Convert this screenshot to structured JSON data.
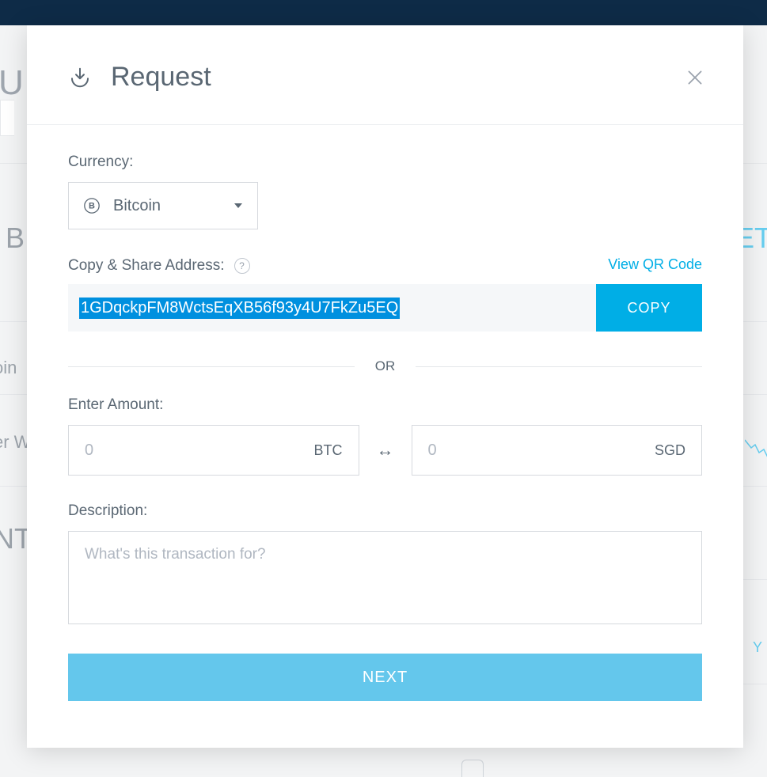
{
  "modal": {
    "title": "Request",
    "currency_label": "Currency:",
    "currency_selected": "Bitcoin",
    "address_label": "Copy & Share Address:",
    "qr_link": "View QR Code",
    "address_value": "1GDqckpFM8WctsEqXB56f93y4U7FkZu5EQ",
    "copy_button": "COPY",
    "or_label": "OR",
    "amount_label": "Enter Amount:",
    "amount_crypto_placeholder": "0",
    "amount_crypto_unit": "BTC",
    "amount_fiat_placeholder": "0",
    "amount_fiat_unit": "SGD",
    "description_label": "Description:",
    "description_placeholder": "What's this transaction for?",
    "next_button": "NEXT"
  },
  "bg": {
    "u": "U",
    "b": "B",
    "oin": "oin",
    "erw": "er W",
    "nt": "NT",
    "et": "ET",
    "y": "Y"
  }
}
